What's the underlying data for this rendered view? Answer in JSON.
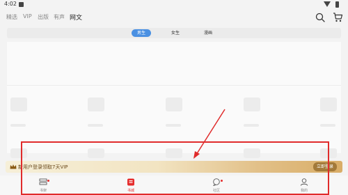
{
  "status_bar": {
    "time": "4:02"
  },
  "top_nav": {
    "tabs": [
      {
        "label": "精选"
      },
      {
        "label": "VIP"
      },
      {
        "label": "出版"
      },
      {
        "label": "有声"
      },
      {
        "label": "网文"
      }
    ],
    "active_tab": "网文"
  },
  "sub_tabs": {
    "items": [
      {
        "label": "男生"
      },
      {
        "label": "女生"
      },
      {
        "label": "漫画"
      }
    ],
    "active": "男生"
  },
  "vip_banner": {
    "text": "新用户登录领取7天VIP",
    "button": "立即登录"
  },
  "bottom_nav": {
    "items": [
      {
        "label": "书架",
        "icon": "bookshelf-icon"
      },
      {
        "label": "书城",
        "icon": "bookstore-icon"
      },
      {
        "label": "社区",
        "icon": "community-icon"
      },
      {
        "label": "我的",
        "icon": "profile-icon"
      }
    ],
    "active": "书城"
  },
  "colors": {
    "accent_blue": "#4a90e2",
    "accent_red": "#e52c2c",
    "vip_gold": "#d9ad67",
    "annotation_red": "#e02b2b"
  }
}
